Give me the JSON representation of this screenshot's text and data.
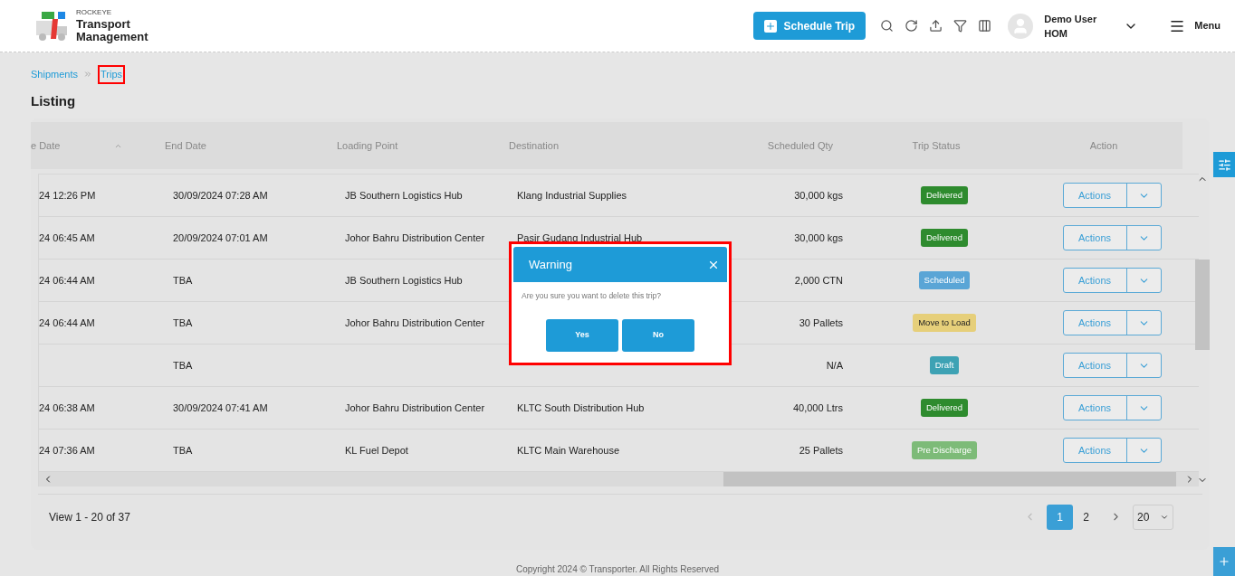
{
  "brand": {
    "small": "ROCKEYE",
    "line1": "Transport",
    "line2": "Management"
  },
  "header": {
    "schedule_button": "Schedule Trip",
    "user_name": "Demo User",
    "user_role": "HOM",
    "menu": "Menu"
  },
  "breadcrumb": [
    {
      "label": "Shipments",
      "highlighted": false
    },
    {
      "label": "Trips",
      "highlighted": true
    }
  ],
  "page_title": "Listing",
  "table": {
    "columns": [
      "e Date",
      "End Date",
      "Loading Point",
      "Destination",
      "Scheduled Qty",
      "Trip Status",
      "Action"
    ],
    "rows": [
      {
        "start": "24 12:26 PM",
        "end": "30/09/2024 07:28 AM",
        "loading": "JB Southern Logistics Hub",
        "destination": "Klang Industrial Supplies",
        "qty": "30,000 kgs",
        "status": "Delivered",
        "color": "#2e8b2e",
        "action": "Actions"
      },
      {
        "start": "24 06:45 AM",
        "end": "20/09/2024 07:01 AM",
        "loading": "Johor Bahru Distribution Center",
        "destination": "Pasir Gudang Industrial Hub",
        "qty": "30,000 kgs",
        "status": "Delivered",
        "color": "#2e8b2e",
        "action": "Actions"
      },
      {
        "start": "24 06:44 AM",
        "end": "TBA",
        "loading": "JB Southern Logistics Hub",
        "qty": "2,000 CTN",
        "status": "Scheduled",
        "color": "#5aa5d6",
        "action": "Actions"
      },
      {
        "start": "24 06:44 AM",
        "end": "TBA",
        "loading": "Johor Bahru Distribution Center",
        "qty": "30 Pallets",
        "status": "Move to Load",
        "color": "#e6cf7a",
        "action": "Actions"
      },
      {
        "end": "TBA",
        "qty": "N/A",
        "status": "Draft",
        "color": "#3ea2b4",
        "action": "Actions"
      },
      {
        "start": "24 06:38 AM",
        "end": "30/09/2024 07:41 AM",
        "loading": "Johor Bahru Distribution Center",
        "destination": "KLTC South Distribution Hub",
        "qty": "40,000 Ltrs",
        "status": "Delivered",
        "color": "#2e8b2e",
        "action": "Actions"
      },
      {
        "start": "24 07:36 AM",
        "end": "TBA",
        "loading": "KL Fuel Depot",
        "destination": "KLTC Main Warehouse",
        "qty": "25 Pallets",
        "status": "Pre Discharge",
        "color": "#7dbb78",
        "action": "Actions"
      }
    ]
  },
  "pagination": {
    "summary": "View 1 - 20 of 37",
    "pages": [
      {
        "label": "1",
        "selected": true
      },
      {
        "label": "2",
        "selected": false
      }
    ],
    "page_size": "20"
  },
  "footer": "Copyright 2024 © Transporter. All Rights Reserved",
  "dialog": {
    "title": "Warning",
    "message": "Are you sure you want to delete this trip?",
    "buttons": [
      "Yes",
      "No"
    ],
    "highlighted": true
  }
}
